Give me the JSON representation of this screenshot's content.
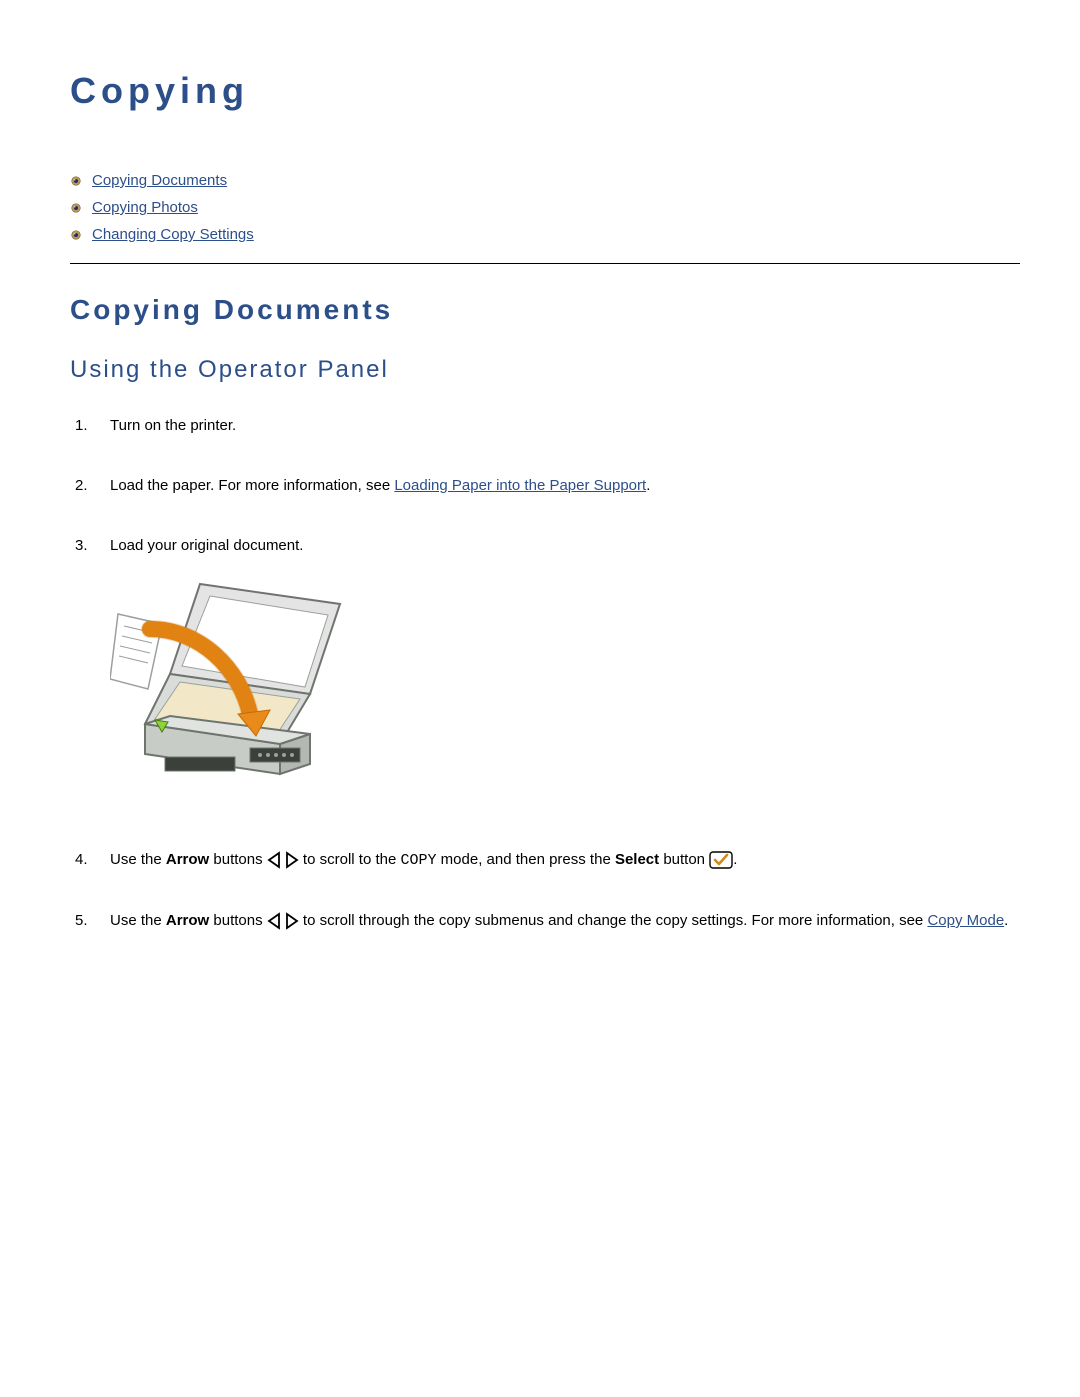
{
  "page": {
    "title": "Copying"
  },
  "toc": {
    "items": [
      {
        "label": "Copying Documents"
      },
      {
        "label": "Copying Photos"
      },
      {
        "label": "Changing Copy Settings"
      }
    ]
  },
  "section": {
    "heading": "Copying Documents",
    "sub": "Using the Operator Panel"
  },
  "steps": {
    "step1": "Turn on the printer.",
    "step2_a": "Load the paper. For more information, see ",
    "step2_link": "Loading Paper into the Paper Support",
    "step2_b": ".",
    "step3": "Load your original document.",
    "step4_a": "Use the ",
    "step4_arrow_label": "Arrow",
    "step4_b": " buttons ",
    "step4_c": " to scroll to the ",
    "step4_mode": "COPY",
    "step4_d": " mode, and then press the ",
    "step4_select_label": "Select",
    "step4_e": " button ",
    "step4_f": ".",
    "step5_a": "Use the ",
    "step5_arrow_label": "Arrow",
    "step5_b": " buttons ",
    "step5_c": " to scroll through the copy submenus and change the copy settings. For more information, see ",
    "step5_link": "Copy Mode",
    "step5_d": "."
  },
  "icons": {
    "bullet": "bullet-icon",
    "arrows": "arrow-buttons-icon",
    "select": "select-button-icon",
    "illustration_alt": "printer-load-document-illustration"
  }
}
